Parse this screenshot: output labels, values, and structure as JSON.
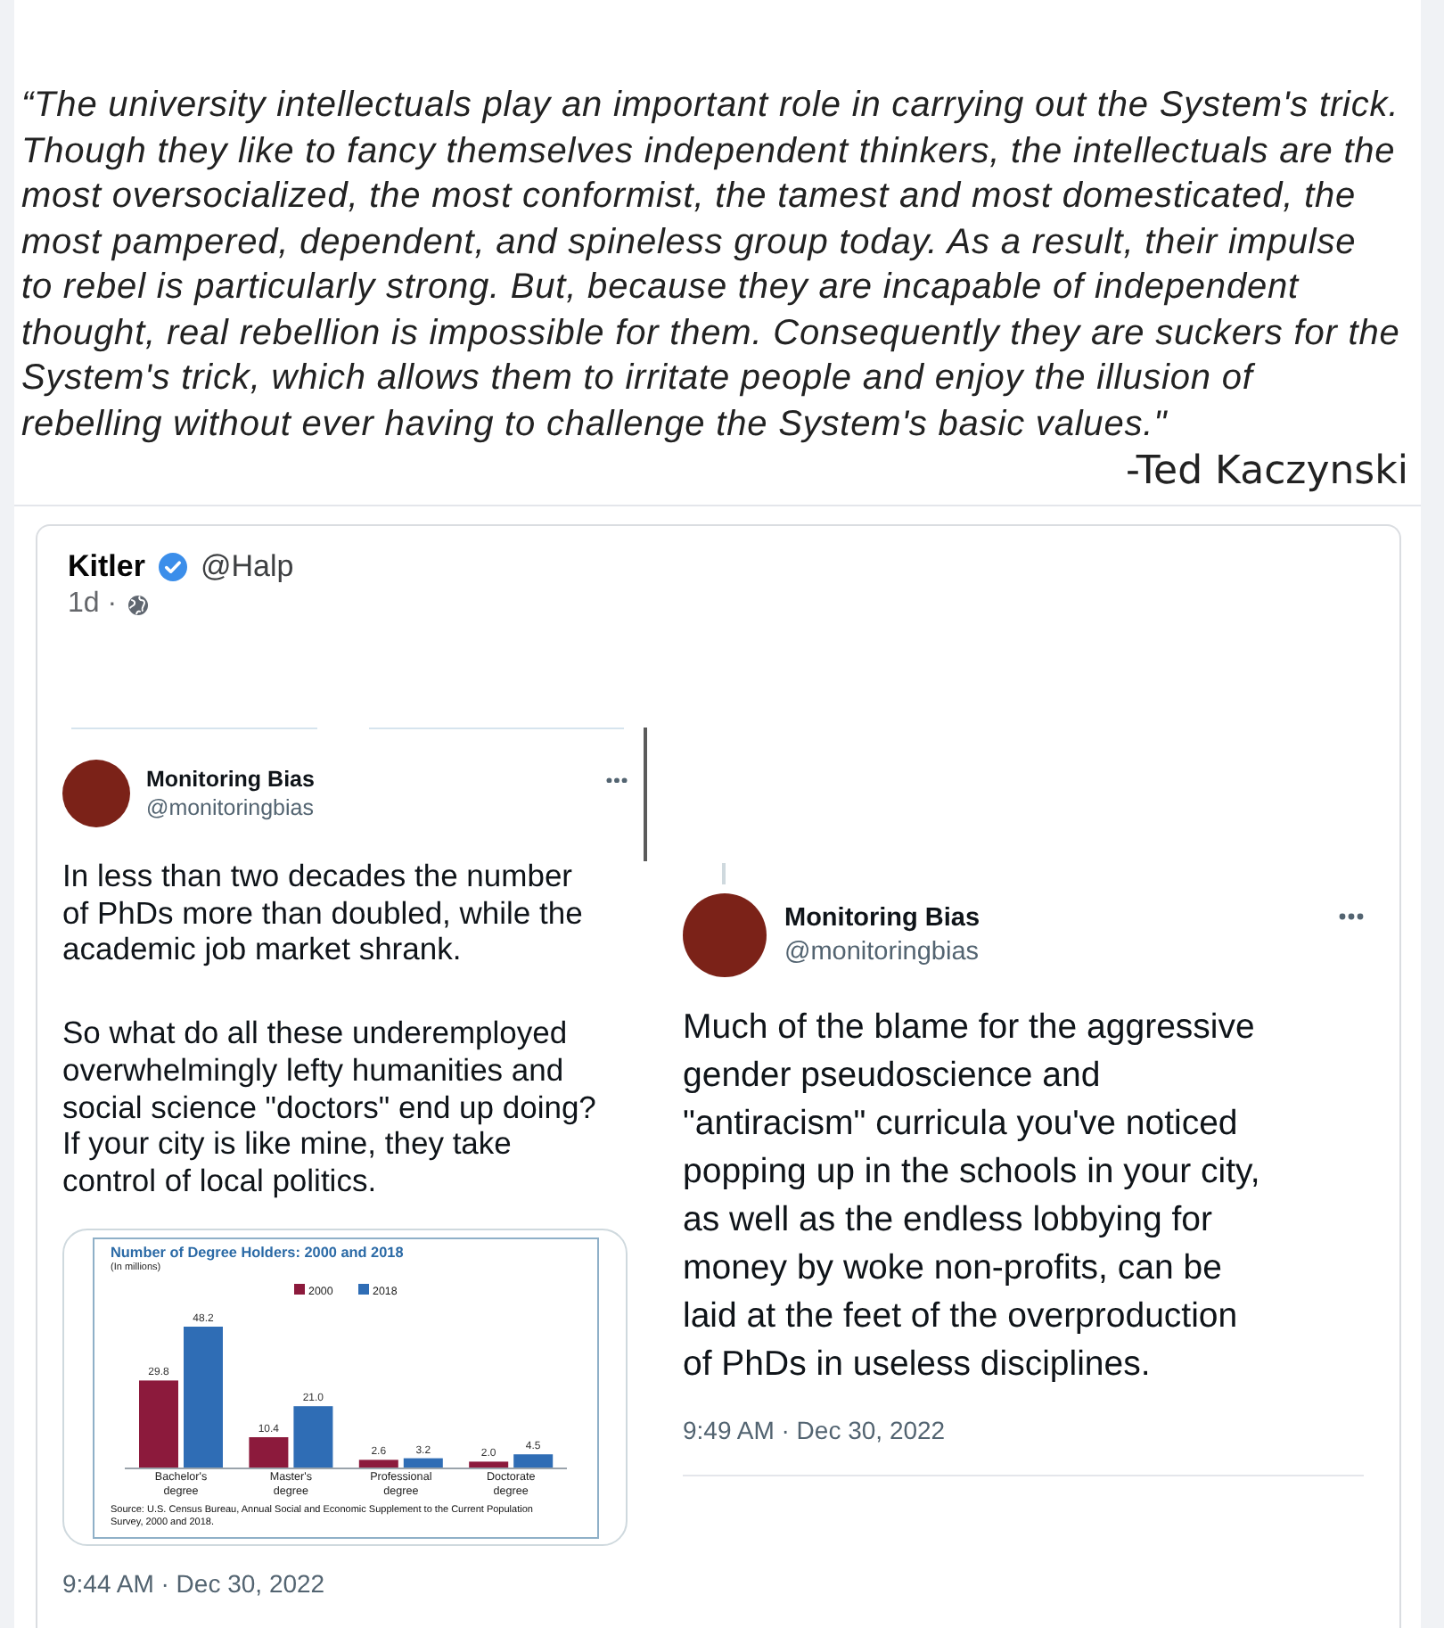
{
  "quote": {
    "text": "“The university intellectuals play an important role in carrying out the System's trick.\nThough they like to fancy themselves independent thinkers, the intellectuals are the\nmost oversocialized, the most conformist, the tamest and most domesticated, the\nmost pampered, dependent, and spineless group today. As a result, their impulse\nto rebel is particularly strong. But, because they are incapable of independent\nthought, real rebellion is impossible for them. Consequently they are suckers for the\nSystem's trick, which allows them to irritate people and enjoy the illusion of\nrebelling without ever having to challenge the System's basic values.\"",
    "attribution": "-Ted Kaczynski"
  },
  "post": {
    "author": "Kitler",
    "verified": true,
    "handle": "@Halp",
    "time": "1d ·"
  },
  "tweets": [
    {
      "kind": "main",
      "author": "Monitoring Bias",
      "handle": "@monitoringbias",
      "paragraphs": [
        "In less than two decades the number\nof PhDs more than doubled, while the\nacademic job market shrank.",
        "So what do all these underemployed\noverwhelmingly lefty humanities and\nsocial science \"doctors\" end up doing?\nIf your city is like mine, they take\ncontrol of local politics."
      ],
      "chart": {
        "chart_data": {
          "type": "bar",
          "title": "Number of Degree Holders: 2000 and 2018",
          "categories": [
            "Bachelor's degree",
            "Master's degree",
            "Professional degree",
            "Doctorate degree"
          ],
          "series": [
            {
              "name": "2000",
              "color": "#8c1a3c",
              "values": [
                29.8,
                10.4,
                2.6,
                2.0
              ],
              "value_labels": [
                "29.8",
                "10.4",
                "2.6",
                "2.0"
              ]
            },
            {
              "name": "2018",
              "color": "#2f6db5",
              "values": [
                48.2,
                21.0,
                3.2,
                4.5
              ],
              "value_labels": [
                "48.2",
                "21.0",
                "3.2",
                "4.5"
              ]
            }
          ],
          "legend": "top"
        },
        "subtitle": "(In millions)",
        "source": "Source: U.S. Census Bureau, Annual Social and Economic Supplement to the Current Population\nSurvey, 2000 and 2018."
      },
      "timestamp": "9:44 AM · Dec 30, 2022"
    },
    {
      "kind": "reply",
      "author": "Monitoring Bias",
      "handle": "@monitoringbias",
      "paragraphs": [
        "Much of the blame for the aggressive\ngender pseudoscience and\n\"antiracism\" curricula you've noticed\npopping up in the schools in your city,\nas well as the endless lobbying for\nmoney by woke non-profits, can be\nlaid at the feet of the overproduction\nof PhDs in useless disciplines."
      ],
      "timestamp": "9:49 AM · Dec 30, 2022"
    }
  ]
}
